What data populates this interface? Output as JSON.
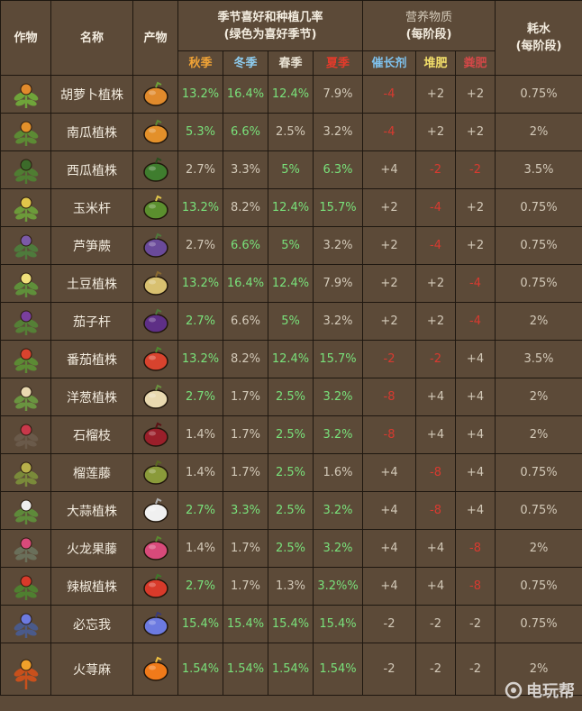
{
  "headers": {
    "crop": "作物",
    "name": "名称",
    "product": "产物",
    "season_group_line1": "季节喜好和种植几率",
    "season_group_line2": "(绿色为喜好季节)",
    "nutrient_group_line1": "营养物质",
    "nutrient_group_line2": "(每阶段)",
    "water_line1": "耗水",
    "water_line2": "(每阶段)",
    "autumn": "秋季",
    "winter": "冬季",
    "spring": "春季",
    "summer": "夏季",
    "growth": "催长剂",
    "compost": "堆肥",
    "manure": "粪肥"
  },
  "rows": [
    {
      "plant_icon": "carrot-plant-icon",
      "name": "胡萝卜植株",
      "product_icon": "carrot-icon",
      "autumn": "13.2%",
      "winter": "16.4%",
      "spring": "12.4%",
      "summer": "7.9%",
      "fav": [
        true,
        true,
        true,
        false
      ],
      "growth": "-4",
      "compost": "+2",
      "manure": "+2",
      "neg": [
        true,
        false,
        false
      ],
      "water": "0.75%"
    },
    {
      "plant_icon": "pumpkin-plant-icon",
      "name": "南瓜植株",
      "product_icon": "pumpkin-icon",
      "autumn": "5.3%",
      "winter": "6.6%",
      "spring": "2.5%",
      "summer": "3.2%",
      "fav": [
        true,
        true,
        false,
        false
      ],
      "growth": "-4",
      "compost": "+2",
      "manure": "+2",
      "neg": [
        true,
        false,
        false
      ],
      "water": "2%"
    },
    {
      "plant_icon": "watermelon-plant-icon",
      "name": "西瓜植株",
      "product_icon": "watermelon-icon",
      "autumn": "2.7%",
      "winter": "3.3%",
      "spring": "5%",
      "summer": "6.3%",
      "fav": [
        false,
        false,
        true,
        true
      ],
      "growth": "+4",
      "compost": "-2",
      "manure": "-2",
      "neg": [
        false,
        true,
        true
      ],
      "water": "3.5%"
    },
    {
      "plant_icon": "corn-plant-icon",
      "name": "玉米杆",
      "product_icon": "corn-icon",
      "autumn": "13.2%",
      "winter": "8.2%",
      "spring": "12.4%",
      "summer": "15.7%",
      "fav": [
        true,
        false,
        true,
        true
      ],
      "growth": "+2",
      "compost": "-4",
      "manure": "+2",
      "neg": [
        false,
        true,
        false
      ],
      "water": "0.75%"
    },
    {
      "plant_icon": "asparagus-plant-icon",
      "name": "芦笋蕨",
      "product_icon": "asparagus-icon",
      "autumn": "2.7%",
      "winter": "6.6%",
      "spring": "5%",
      "summer": "3.2%",
      "fav": [
        false,
        true,
        true,
        false
      ],
      "growth": "+2",
      "compost": "-4",
      "manure": "+2",
      "neg": [
        false,
        true,
        false
      ],
      "water": "0.75%"
    },
    {
      "plant_icon": "potato-plant-icon",
      "name": "土豆植株",
      "product_icon": "potato-icon",
      "autumn": "13.2%",
      "winter": "16.4%",
      "spring": "12.4%",
      "summer": "7.9%",
      "fav": [
        true,
        true,
        true,
        false
      ],
      "growth": "+2",
      "compost": "+2",
      "manure": "-4",
      "neg": [
        false,
        false,
        true
      ],
      "water": "0.75%"
    },
    {
      "plant_icon": "eggplant-plant-icon",
      "name": "茄子杆",
      "product_icon": "eggplant-icon",
      "autumn": "2.7%",
      "winter": "6.6%",
      "spring": "5%",
      "summer": "3.2%",
      "fav": [
        true,
        false,
        true,
        false
      ],
      "growth": "+2",
      "compost": "+2",
      "manure": "-4",
      "neg": [
        false,
        false,
        true
      ],
      "water": "2%"
    },
    {
      "plant_icon": "tomato-plant-icon",
      "name": "番茄植株",
      "product_icon": "tomato-icon",
      "autumn": "13.2%",
      "winter": "8.2%",
      "spring": "12.4%",
      "summer": "15.7%",
      "fav": [
        true,
        false,
        true,
        true
      ],
      "growth": "-2",
      "compost": "-2",
      "manure": "+4",
      "neg": [
        true,
        true,
        false
      ],
      "water": "3.5%"
    },
    {
      "plant_icon": "onion-plant-icon",
      "name": "洋葱植株",
      "product_icon": "onion-icon",
      "autumn": "2.7%",
      "winter": "1.7%",
      "spring": "2.5%",
      "summer": "3.2%",
      "fav": [
        true,
        false,
        true,
        true
      ],
      "growth": "-8",
      "compost": "+4",
      "manure": "+4",
      "neg": [
        true,
        false,
        false
      ],
      "water": "2%"
    },
    {
      "plant_icon": "pomegranate-plant-icon",
      "name": "石榴枝",
      "product_icon": "pomegranate-icon",
      "autumn": "1.4%",
      "winter": "1.7%",
      "spring": "2.5%",
      "summer": "3.2%",
      "fav": [
        false,
        false,
        true,
        true
      ],
      "growth": "-8",
      "compost": "+4",
      "manure": "+4",
      "neg": [
        true,
        false,
        false
      ],
      "water": "2%"
    },
    {
      "plant_icon": "durian-plant-icon",
      "name": "榴莲藤",
      "product_icon": "durian-icon",
      "autumn": "1.4%",
      "winter": "1.7%",
      "spring": "2.5%",
      "summer": "1.6%",
      "fav": [
        false,
        false,
        true,
        false
      ],
      "growth": "+4",
      "compost": "-8",
      "manure": "+4",
      "neg": [
        false,
        true,
        false
      ],
      "water": "0.75%"
    },
    {
      "plant_icon": "garlic-plant-icon",
      "name": "大蒜植株",
      "product_icon": "garlic-icon",
      "autumn": "2.7%",
      "winter": "3.3%",
      "spring": "2.5%",
      "summer": "3.2%",
      "fav": [
        true,
        true,
        true,
        true
      ],
      "growth": "+4",
      "compost": "-8",
      "manure": "+4",
      "neg": [
        false,
        true,
        false
      ],
      "water": "0.75%"
    },
    {
      "plant_icon": "dragonfruit-plant-icon",
      "name": "火龙果藤",
      "product_icon": "dragonfruit-icon",
      "autumn": "1.4%",
      "winter": "1.7%",
      "spring": "2.5%",
      "summer": "3.2%",
      "fav": [
        false,
        false,
        true,
        true
      ],
      "growth": "+4",
      "compost": "+4",
      "manure": "-8",
      "neg": [
        false,
        false,
        true
      ],
      "water": "2%"
    },
    {
      "plant_icon": "pepper-plant-icon",
      "name": "辣椒植株",
      "product_icon": "pepper-icon",
      "autumn": "2.7%",
      "winter": "1.7%",
      "spring": "1.3%",
      "summer": "3.2%%",
      "fav": [
        true,
        false,
        false,
        true
      ],
      "growth": "+4",
      "compost": "+4",
      "manure": "-8",
      "neg": [
        false,
        false,
        true
      ],
      "water": "0.75%"
    },
    {
      "plant_icon": "forget-me-lots-plant-icon",
      "name": "必忘我",
      "product_icon": "forget-me-lots-icon",
      "autumn": "15.4%",
      "winter": "15.4%",
      "spring": "15.4%",
      "summer": "15.4%",
      "fav": [
        true,
        true,
        true,
        true
      ],
      "growth": "-2",
      "compost": "-2",
      "manure": "-2",
      "neg": [
        false,
        false,
        false
      ],
      "water": "0.75%"
    },
    {
      "plant_icon": "fire-nettle-plant-icon",
      "name": "火荨麻",
      "product_icon": "fire-nettle-icon",
      "autumn": "1.54%",
      "winter": "1.54%",
      "spring": "1.54%",
      "summer": "1.54%",
      "fav": [
        true,
        true,
        true,
        true
      ],
      "growth": "-2",
      "compost": "-2",
      "manure": "-2",
      "neg": [
        false,
        false,
        false
      ],
      "water": "2%"
    }
  ],
  "watermark": "电玩帮",
  "colors": {
    "background": "#5c4a38",
    "grid": "#1e1710",
    "favorite_green": "#79e17a",
    "negative_red": "#d83a30",
    "autumn": "#f0a336",
    "winter": "#8ecdf0",
    "summer": "#e23b2b",
    "growth": "#7fc2ee",
    "compost": "#f4e06a",
    "manure": "#d44848"
  }
}
